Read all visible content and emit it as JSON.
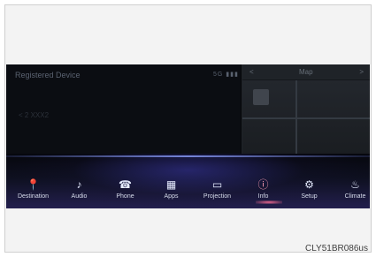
{
  "screen": {
    "title": "Registered Device",
    "signal_text": "5G ▮▮▮",
    "map_header": {
      "left_arrow": "<",
      "title": "Map",
      "right_arrow": ">"
    },
    "left_dim_text": "< 2 XXX2"
  },
  "dock": [
    {
      "label": "Destination",
      "icon": "📍",
      "active": false
    },
    {
      "label": "Audio",
      "icon": "♪",
      "active": false
    },
    {
      "label": "Phone",
      "icon": "☎",
      "active": false
    },
    {
      "label": "Apps",
      "icon": "▦",
      "active": false
    },
    {
      "label": "Projection",
      "icon": "▭",
      "active": false
    },
    {
      "label": "Info",
      "icon": "ⓘ",
      "active": true
    },
    {
      "label": "Setup",
      "icon": "⚙",
      "active": false
    },
    {
      "label": "Climate",
      "icon": "♨",
      "active": false
    }
  ],
  "caption": "CLY51BR086us"
}
